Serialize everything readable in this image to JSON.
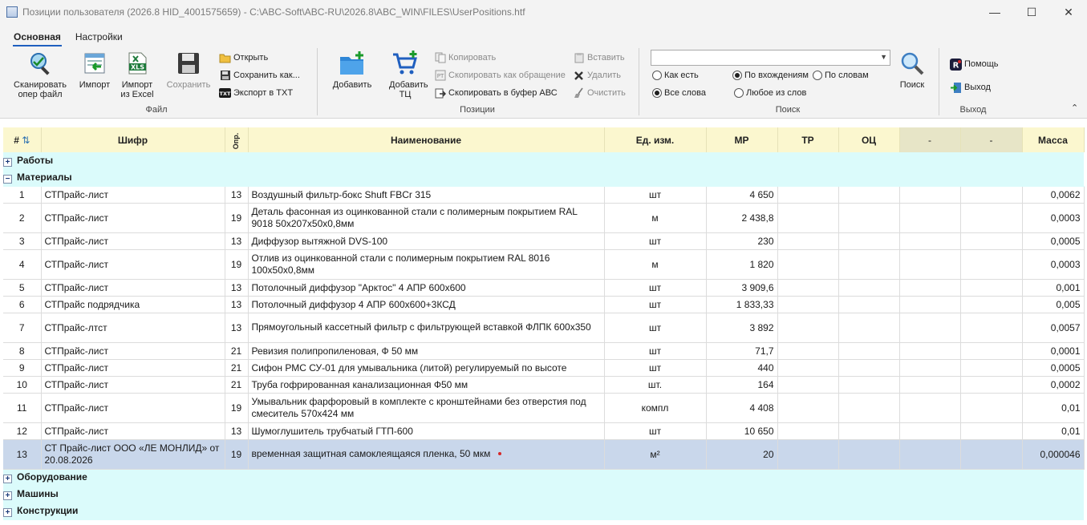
{
  "window": {
    "title": "Позиции пользователя (2026.8 HID_4001575659) - C:\\ABC-Soft\\ABC-RU\\2026.8\\ABC_WIN\\FILES\\UserPositions.htf",
    "minimize": "—",
    "maximize": "☐",
    "close": "✕"
  },
  "tabs": [
    {
      "label": "Основная",
      "active": true
    },
    {
      "label": "Настройки",
      "active": false
    }
  ],
  "ribbon": {
    "file": {
      "scan": "Сканировать опер файл",
      "import": "Импорт",
      "import_excel": "Импорт из Excel",
      "save": "Сохранить",
      "open": "Открыть",
      "save_as": "Сохранить как...",
      "export_txt": "Экспорт в TXT",
      "label": "Файл"
    },
    "positions": {
      "add": "Добавить",
      "add_tc": "Добавить ТЦ",
      "copy": "Копировать",
      "copy_as_ref": "Скопировать как обращение",
      "copy_buffer": "Скопировать в буфер АВС",
      "paste": "Вставить",
      "delete": "Удалить",
      "clear": "Очистить",
      "label": "Позиции"
    },
    "search": {
      "query": "",
      "as_is": "Как есть",
      "by_occurrence": "По вхождениям",
      "by_words": "По словам",
      "all_words": "Все слова",
      "any_word": "Любое из слов",
      "button": "Поиск",
      "label": "Поиск",
      "selected": [
        "by_occurrence",
        "all_words"
      ]
    },
    "exit": {
      "help": "Помощь",
      "exit": "Выход",
      "label": "Выход"
    }
  },
  "grid": {
    "columns": [
      "#",
      "Шифр",
      "Опр.",
      "Наименование",
      "Ед. изм.",
      "МР",
      "ТР",
      "ОЦ",
      "-",
      "-",
      "Масса"
    ],
    "groups_top": [
      {
        "label": "Работы",
        "expanded": false
      },
      {
        "label": "Материалы",
        "expanded": true
      }
    ],
    "rows": [
      {
        "n": "1",
        "code": "СТПрайс-лист",
        "opr": "13",
        "name": "Воздушный фильтр-бокс Shuft  FBCr 315",
        "unit": "шт",
        "mr": "4 650",
        "mass": "0,0062"
      },
      {
        "n": "2",
        "code": "СТПрайс-лист",
        "opr": "19",
        "name": "Деталь фасонная из оцинкованной стали с полимерным покрытием RAL 9018 50х207х50х0,8мм",
        "unit": "м",
        "mr": "2 438,8",
        "mass": "0,0003"
      },
      {
        "n": "3",
        "code": "СТПрайс-лист",
        "opr": "13",
        "name": "Диффузор вытяжной DVS-100",
        "unit": "шт",
        "mr": "230",
        "mass": "0,0005"
      },
      {
        "n": "4",
        "code": "СТПрайс-лист",
        "opr": "19",
        "name": "Отлив из оцинкованной стали с полимерным покрытием RAL 8016 100х50х0,8мм",
        "unit": "м",
        "mr": "1 820",
        "mass": "0,0003"
      },
      {
        "n": "5",
        "code": "СТПрайс-лист",
        "opr": "13",
        "name": "Потолочный диффузор \"Арктос\" 4 АПР 600х600",
        "unit": "шт",
        "mr": "3 909,6",
        "mass": "0,001"
      },
      {
        "n": "6",
        "code": "СТПрайс подрядчика",
        "opr": "13",
        "name": "Потолочный диффузор 4 АПР 600х600+3КСД",
        "unit": "шт",
        "mr": "1 833,33",
        "mass": "0,005"
      },
      {
        "n": "7",
        "code": "СТПрайс-лтст",
        "opr": "13",
        "name": "Прямоугольный кассетный фильтр с фильтрующей вставкой ФЛПК 600х350",
        "unit": "шт",
        "mr": "3 892",
        "mass": "0,0057"
      },
      {
        "n": "8",
        "code": "СТПрайс-лист",
        "opr": "21",
        "name": "Ревизия полипропиленовая, Ф 50 мм",
        "unit": "шт",
        "mr": "71,7",
        "mass": "0,0001"
      },
      {
        "n": "9",
        "code": "СТПрайс-лист",
        "opr": "21",
        "name": "Сифон РМС СУ-01 для умывальника (литой) регулируемый по высоте",
        "unit": "шт",
        "mr": "440",
        "mass": "0,0005"
      },
      {
        "n": "10",
        "code": "СТПрайс-лист",
        "opr": "21",
        "name": "Труба гофрированная канализационная Ф50 мм",
        "unit": "шт.",
        "mr": "164",
        "mass": "0,0002"
      },
      {
        "n": "11",
        "code": "СТПрайс-лист",
        "opr": "19",
        "name": "Умывальник фарфоровый в комплекте с кронштейнами без отверстия под смеситель 570х424 мм",
        "unit": "компл",
        "mr": "4 408",
        "mass": "0,01"
      },
      {
        "n": "12",
        "code": "СТПрайс-лист",
        "opr": "13",
        "name": "Шумоглушитель трубчатый ГТП-600",
        "unit": "шт",
        "mr": "10 650",
        "mass": "0,01"
      },
      {
        "n": "13",
        "code": "СТ Прайс-лист ООО «ЛЕ МОНЛИД» от 20.08.2026",
        "opr": "19",
        "name": "временная защитная самоклеящаяся пленка, 50 мкм",
        "unit": "м²",
        "mr": "20",
        "mass": "0,000046"
      }
    ],
    "groups_bottom": [
      {
        "label": "Оборудование",
        "expanded": false
      },
      {
        "label": "Машины",
        "expanded": false
      },
      {
        "label": "Конструкции",
        "expanded": false
      }
    ]
  }
}
